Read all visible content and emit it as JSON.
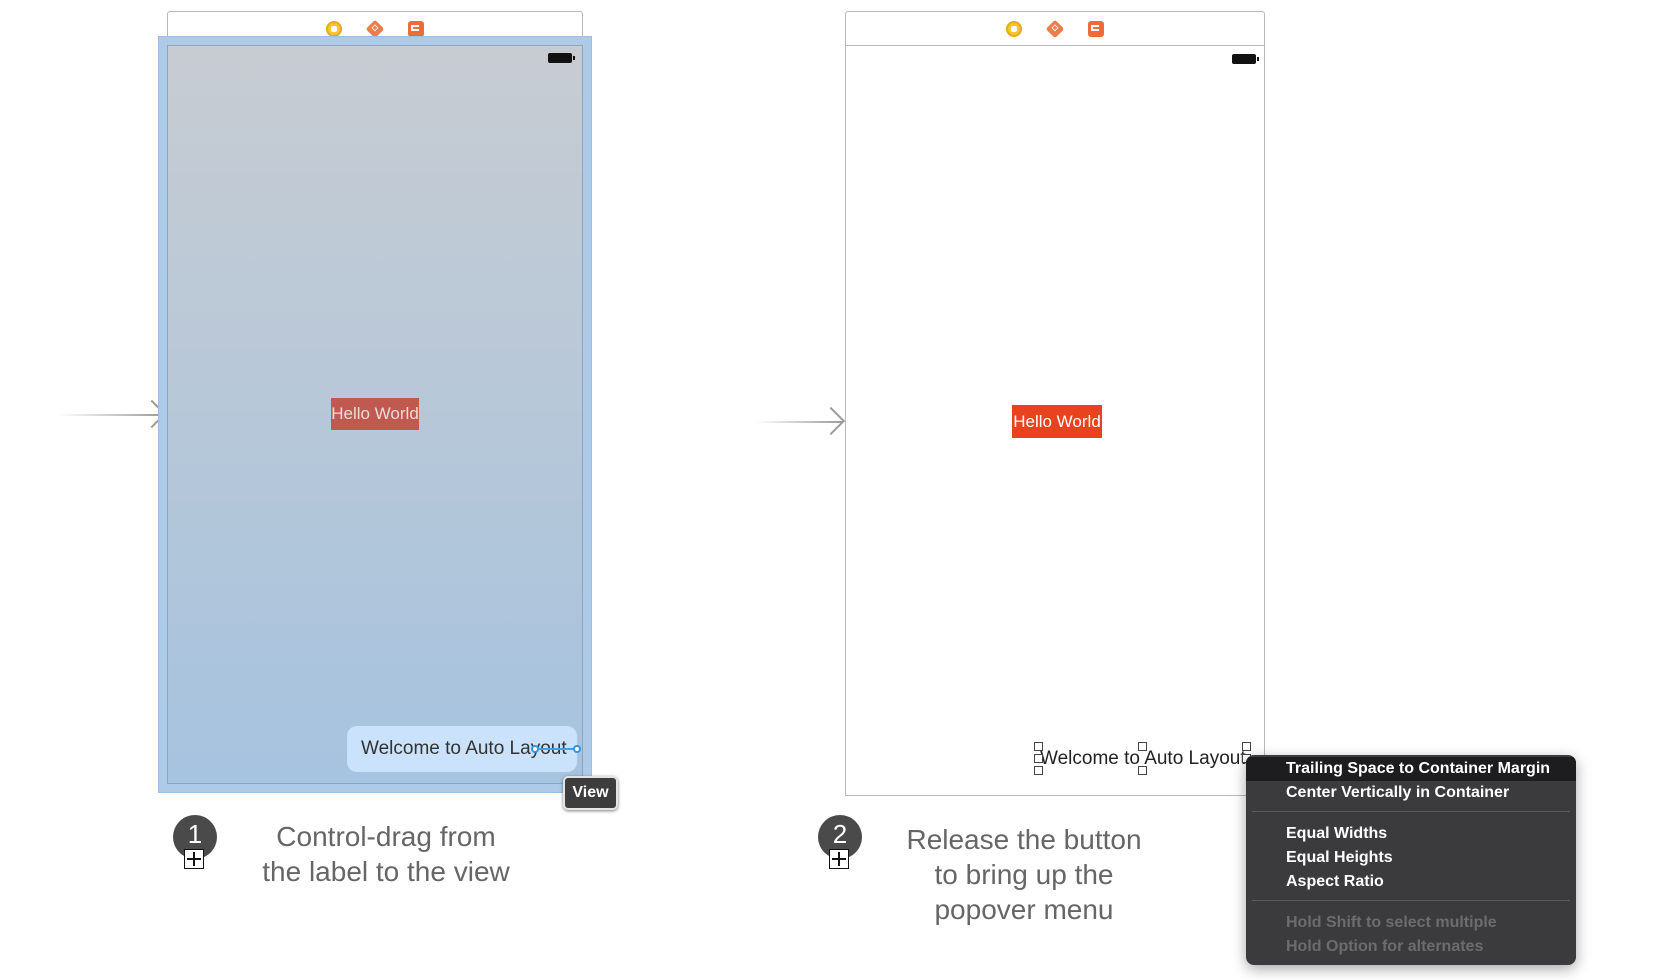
{
  "left_panel": {
    "scene_icons": [
      "view-controller-icon",
      "first-responder-icon",
      "exit-icon"
    ],
    "hello_label": "Hello World",
    "welcome_label": "Welcome to Auto Layout",
    "drop_target_tooltip": "View",
    "step_number": "1",
    "caption_line1": "Control-drag from",
    "caption_line2": "the label to the view"
  },
  "right_panel": {
    "scene_icons": [
      "view-controller-icon",
      "first-responder-icon",
      "exit-icon"
    ],
    "hello_label": "Hello World",
    "welcome_label": "Welcome to Auto Layout",
    "step_number": "2",
    "caption_line1": "Release the button",
    "caption_line2": "to bring up the",
    "caption_line3": "popover menu"
  },
  "popover_menu": {
    "items": [
      {
        "label": "Trailing Space to Container Margin",
        "selected": true
      },
      {
        "label": "Center Vertically in Container"
      },
      {
        "label": "Equal Widths"
      },
      {
        "label": "Equal Heights"
      },
      {
        "label": "Aspect Ratio"
      }
    ],
    "hints": [
      "Hold Shift to select multiple",
      "Hold Option for alternates"
    ]
  },
  "colors": {
    "hello_label_bg": "#e9421f",
    "hello_label_bg_dimmed": "#c05a50",
    "drag_line": "#3aa3f0",
    "menu_bg": "#3b3b3d"
  }
}
